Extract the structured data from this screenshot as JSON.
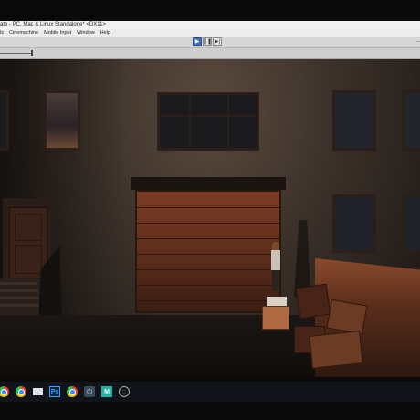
{
  "window": {
    "title": "ate - PC, Mac & Linux Standalone* <DX11>"
  },
  "menu": {
    "items": [
      "ols",
      "Cinemachine",
      "Mobile Input",
      "Window",
      "Help"
    ]
  },
  "toolbar": {
    "play_icon": "play-icon",
    "pause_icon": "pause-icon",
    "step_icon": "step-icon",
    "play_active": true,
    "layout_label": "..."
  },
  "taskbar": {
    "icons": [
      "chrome-icon",
      "chrome-icon",
      "mail-icon",
      "photoshop-icon",
      "chrome-icon",
      "unity-icon",
      "chart-icon",
      "circle-icon"
    ],
    "photoshop_label": "Ps",
    "unity_label": "⬡",
    "chart_label": "M"
  },
  "colors": {
    "play_active": "#3f6fb5",
    "garage_door": "#7b3b24",
    "wall": "#3a3029"
  }
}
